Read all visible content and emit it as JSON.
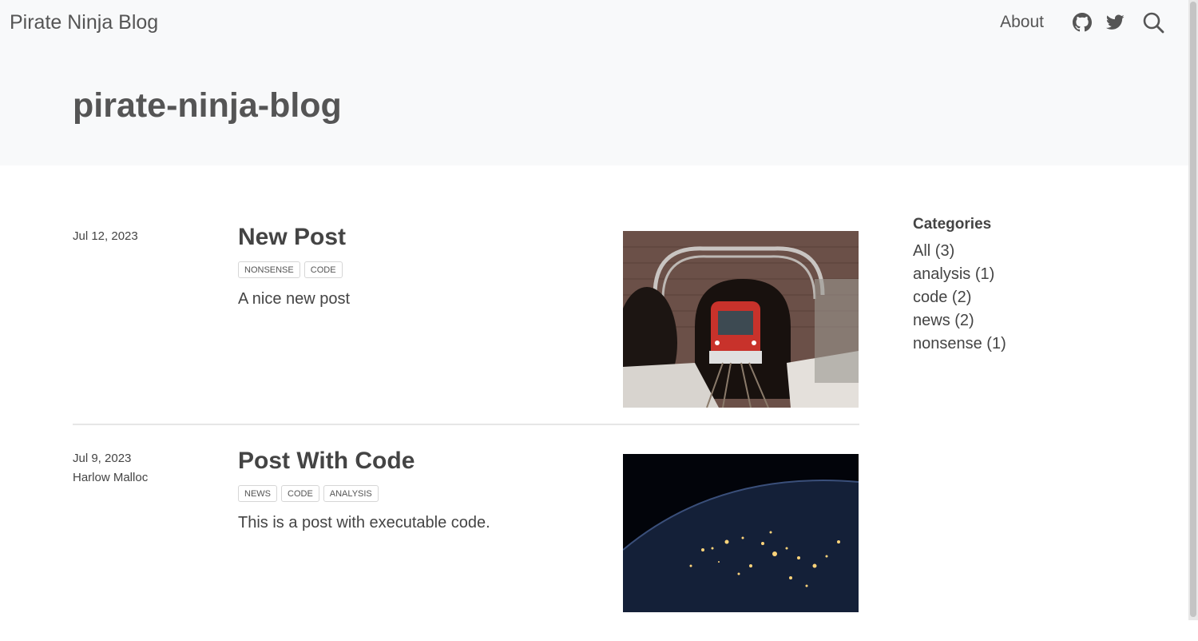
{
  "navbar": {
    "brand": "Pirate Ninja Blog",
    "about": "About",
    "icons": [
      "github-icon",
      "twitter-icon",
      "search-icon"
    ]
  },
  "banner": {
    "title": "pirate-ninja-blog"
  },
  "posts": [
    {
      "date": "Jul 12, 2023",
      "author": "",
      "title": "New Post",
      "categories": [
        "NONSENSE",
        "CODE"
      ],
      "excerpt": "A nice new post"
    },
    {
      "date": "Jul 9, 2023",
      "author": "Harlow Malloc",
      "title": "Post With Code",
      "categories": [
        "NEWS",
        "CODE",
        "ANALYSIS"
      ],
      "excerpt": "This is a post with executable code."
    }
  ],
  "sidebar": {
    "heading": "Categories",
    "items": [
      "All (3)",
      "analysis (1)",
      "code (2)",
      "news (2)",
      "nonsense (1)"
    ]
  },
  "colors": {
    "banner_bg": "#f8f9fa",
    "text": "#404040",
    "divider": "#e6e6e6"
  }
}
